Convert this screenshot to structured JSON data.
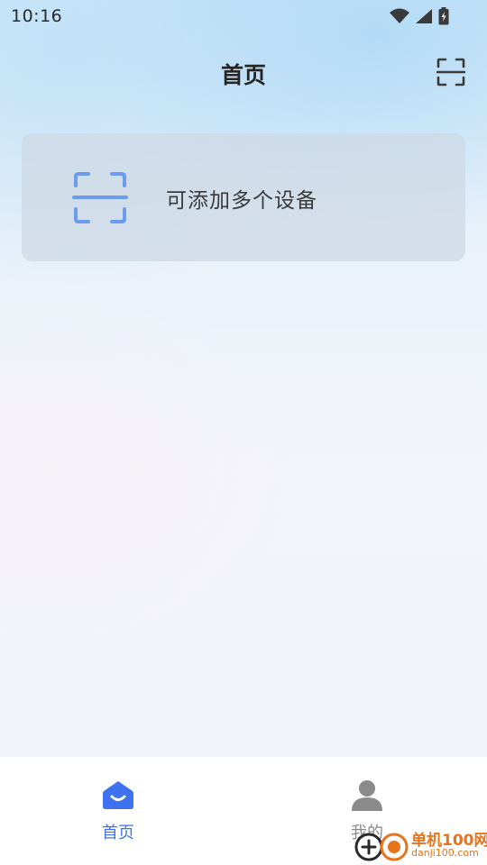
{
  "status_bar": {
    "time": "10:16",
    "icons": [
      "wifi-icon",
      "cellular-signal-icon",
      "battery-charging-icon"
    ]
  },
  "header": {
    "title": "首页",
    "scan_icon": "scan-icon"
  },
  "add_device_card": {
    "label": "可添加多个设备",
    "icon": "scan-icon"
  },
  "bottom_nav": {
    "items": [
      {
        "label": "首页",
        "icon": "home-icon",
        "active": true
      },
      {
        "label": "我的",
        "icon": "person-icon",
        "active": false
      }
    ]
  },
  "watermark": {
    "title": "单机100网",
    "url": "danji100.com"
  },
  "colors": {
    "accent": "#3e72f0",
    "card_icon": "#6f9bef",
    "inactive": "#8a8a8a",
    "card_bg": "#ced9e5",
    "watermark": "#e8731a"
  }
}
